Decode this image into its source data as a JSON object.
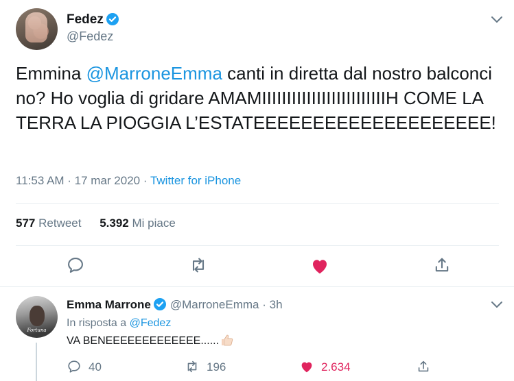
{
  "tweet": {
    "author_name": "Fedez",
    "author_handle": "@Fedez",
    "text_before_mention": "Emmina ",
    "mention": "@MarroneEmma",
    "text_after_mention": " canti in diretta dal nostro balconcino? Ho voglia di gridare AMAMIIIIIIIIIIIIIIIIIIIIIIIIIH COME LA TERRA LA PIOGGIA L’ESTATEEEEEEEEEEEEEEEEEEEE!",
    "time_date": "11:53 AM · 17 mar 2020 · ",
    "source": "Twitter for iPhone",
    "retweet_count": "577",
    "retweet_label": "Retweet",
    "like_count": "5.392",
    "like_label": "Mi piace"
  },
  "reply": {
    "author_name": "Emma Marrone",
    "author_handle": "@MarroneEmma",
    "time": "· 3h",
    "reply_to_label": "In risposta a ",
    "reply_to_handle": "@Fedez",
    "text": "VA BENEEEEEEEEEEEEE......",
    "avatar_caption": "Fortuna",
    "reply_count": "40",
    "retweet_count": "196",
    "like_count": "2.634"
  },
  "colors": {
    "accent": "#1b95e0",
    "verified": "#1da1f2",
    "like": "#e0245e",
    "muted": "#657786",
    "divider": "#e6ecf0"
  },
  "icons": [
    "verified-badge-icon",
    "chevron-down-icon",
    "reply-icon",
    "retweet-icon",
    "heart-icon",
    "share-icon",
    "thumbs-up-emoji"
  ]
}
